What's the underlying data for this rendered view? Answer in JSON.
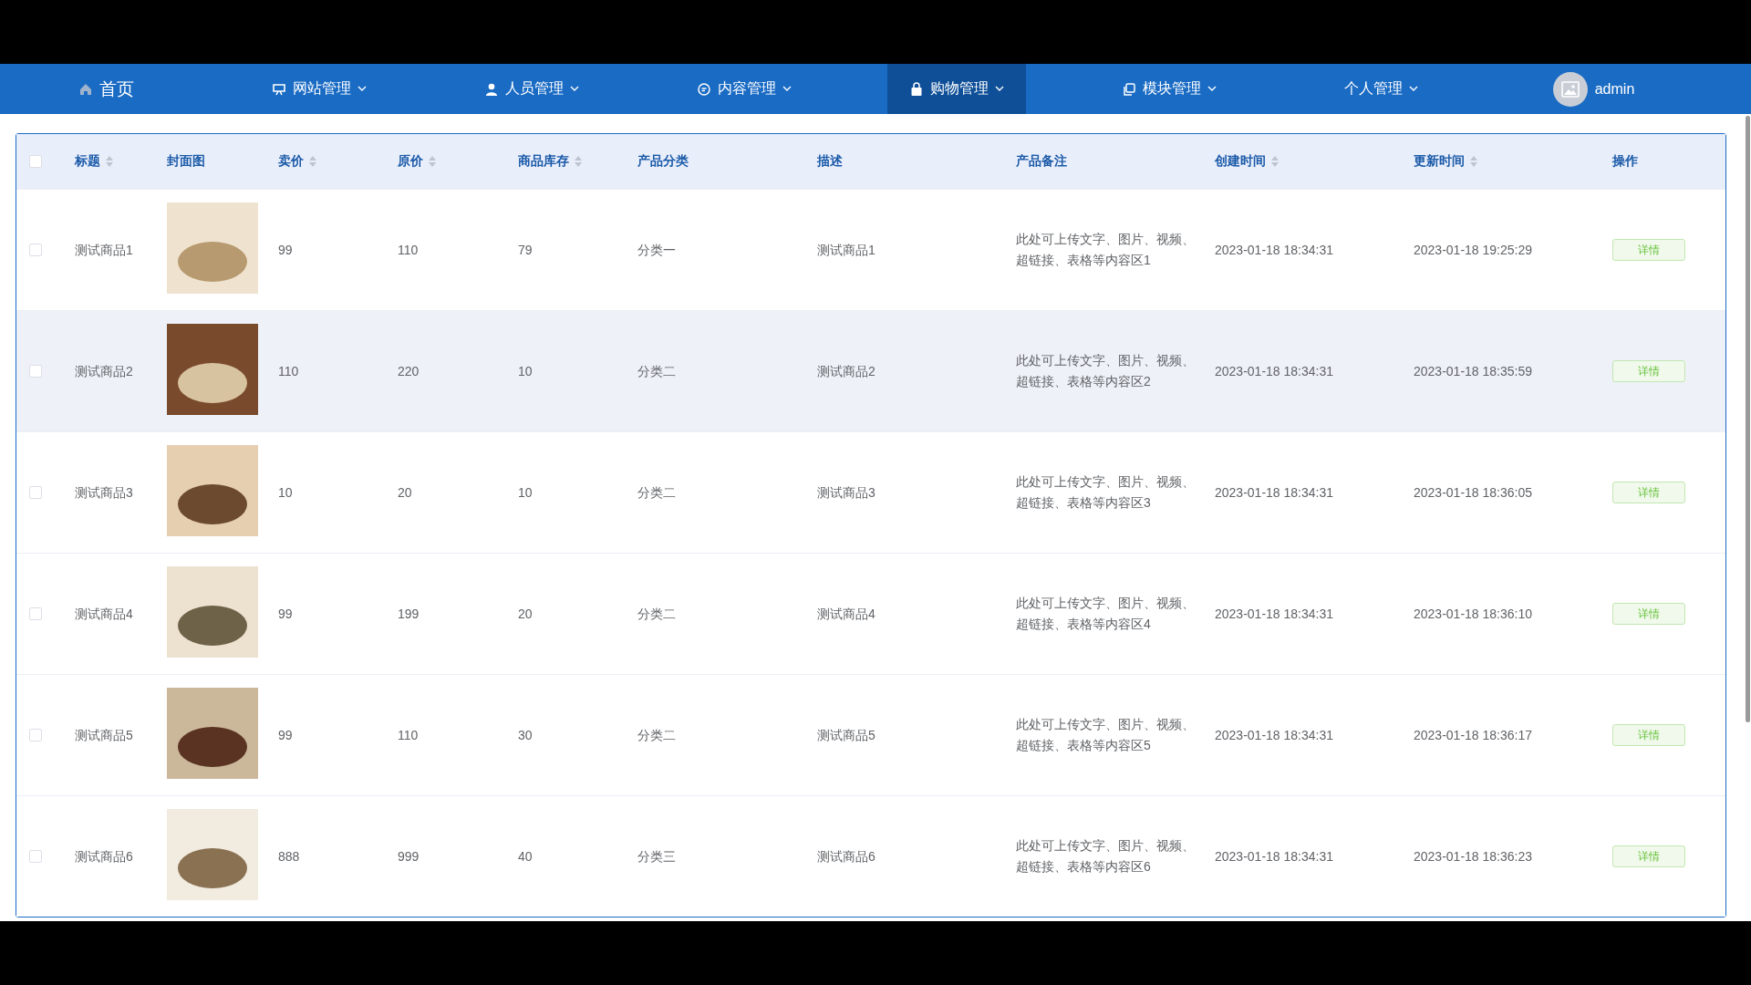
{
  "nav": {
    "items": [
      {
        "label": "首页",
        "dropdown": false,
        "selected": false
      },
      {
        "label": "网站管理",
        "dropdown": true,
        "selected": false
      },
      {
        "label": "人员管理",
        "dropdown": true,
        "selected": false
      },
      {
        "label": "内容管理",
        "dropdown": true,
        "selected": false
      },
      {
        "label": "购物管理",
        "dropdown": true,
        "selected": true
      },
      {
        "label": "模块管理",
        "dropdown": true,
        "selected": false
      },
      {
        "label": "个人管理",
        "dropdown": true,
        "selected": false
      }
    ],
    "user": "admin"
  },
  "table": {
    "select_all_checked": false,
    "columns": [
      {
        "label": "标题",
        "sortable": true
      },
      {
        "label": "封面图",
        "sortable": false
      },
      {
        "label": "卖价",
        "sortable": true
      },
      {
        "label": "原价",
        "sortable": true
      },
      {
        "label": "商品库存",
        "sortable": true
      },
      {
        "label": "产品分类",
        "sortable": false
      },
      {
        "label": "描述",
        "sortable": false
      },
      {
        "label": "产品备注",
        "sortable": false
      },
      {
        "label": "创建时间",
        "sortable": true
      },
      {
        "label": "更新时间",
        "sortable": true
      },
      {
        "label": "操作",
        "sortable": false
      }
    ],
    "rows": [
      {
        "checked": false,
        "highlighted": false,
        "title": "测试商品1",
        "price": "99",
        "original_price": "110",
        "stock": "79",
        "category": "分类一",
        "description": "测试商品1",
        "note": "此处可上传文字、图片、视频、超链接、表格等内容区1",
        "created": "2023-01-18 18:34:31",
        "updated": "2023-01-18 19:25:29",
        "action": "详情"
      },
      {
        "checked": false,
        "highlighted": true,
        "title": "测试商品2",
        "price": "110",
        "original_price": "220",
        "stock": "10",
        "category": "分类二",
        "description": "测试商品2",
        "note": "此处可上传文字、图片、视频、超链接、表格等内容区2",
        "created": "2023-01-18 18:34:31",
        "updated": "2023-01-18 18:35:59",
        "action": "详情"
      },
      {
        "checked": false,
        "highlighted": false,
        "title": "测试商品3",
        "price": "10",
        "original_price": "20",
        "stock": "10",
        "category": "分类二",
        "description": "测试商品3",
        "note": "此处可上传文字、图片、视频、超链接、表格等内容区3",
        "created": "2023-01-18 18:34:31",
        "updated": "2023-01-18 18:36:05",
        "action": "详情"
      },
      {
        "checked": false,
        "highlighted": false,
        "title": "测试商品4",
        "price": "99",
        "original_price": "199",
        "stock": "20",
        "category": "分类二",
        "description": "测试商品4",
        "note": "此处可上传文字、图片、视频、超链接、表格等内容区4",
        "created": "2023-01-18 18:34:31",
        "updated": "2023-01-18 18:36:10",
        "action": "详情"
      },
      {
        "checked": false,
        "highlighted": false,
        "title": "测试商品5",
        "price": "99",
        "original_price": "110",
        "stock": "30",
        "category": "分类二",
        "description": "测试商品5",
        "note": "此处可上传文字、图片、视频、超链接、表格等内容区5",
        "created": "2023-01-18 18:34:31",
        "updated": "2023-01-18 18:36:17",
        "action": "详情"
      },
      {
        "checked": false,
        "highlighted": false,
        "title": "测试商品6",
        "price": "888",
        "original_price": "999",
        "stock": "40",
        "category": "分类三",
        "description": "测试商品6",
        "note": "此处可上传文字、图片、视频、超链接、表格等内容区6",
        "created": "2023-01-18 18:34:31",
        "updated": "2023-01-18 18:36:23",
        "action": "详情"
      }
    ]
  }
}
